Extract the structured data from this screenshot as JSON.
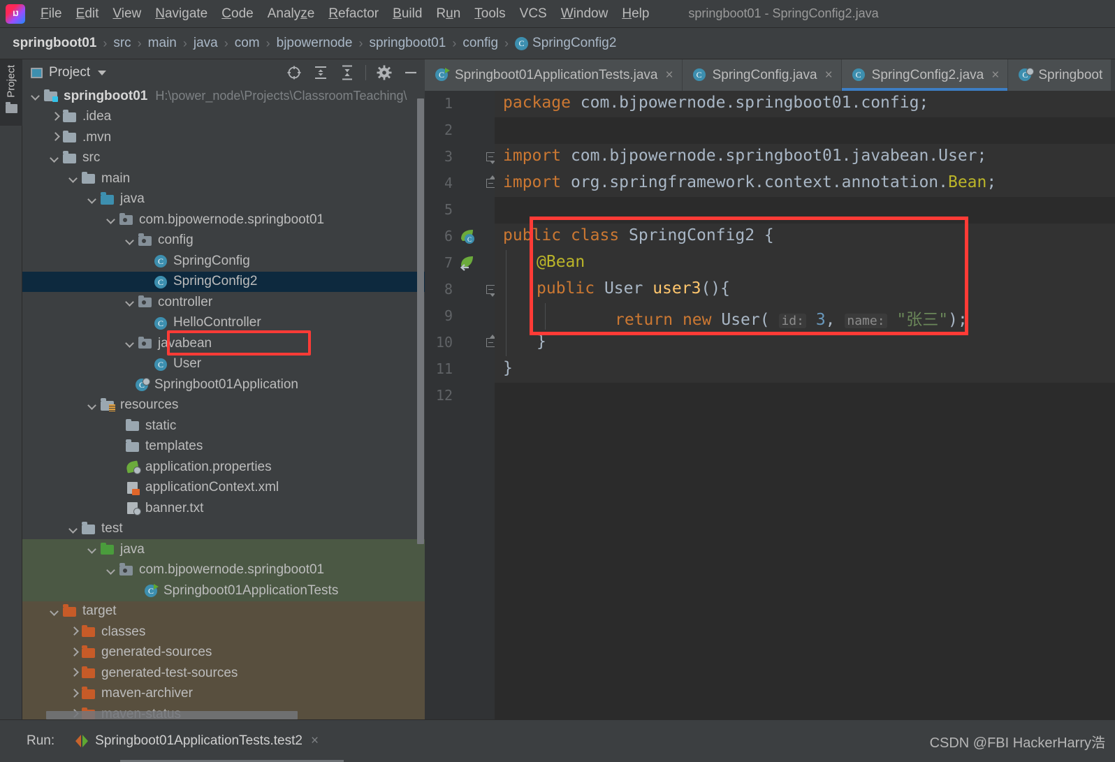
{
  "window": {
    "title": "springboot01 - SpringConfig2.java",
    "logo_icon": "intellij-idea-logo"
  },
  "menubar": {
    "items": [
      {
        "label": "File",
        "mnemonic": "F"
      },
      {
        "label": "Edit",
        "mnemonic": "E"
      },
      {
        "label": "View",
        "mnemonic": "V"
      },
      {
        "label": "Navigate",
        "mnemonic": "N"
      },
      {
        "label": "Code",
        "mnemonic": "C"
      },
      {
        "label": "Analyze",
        "mnemonic": "z"
      },
      {
        "label": "Refactor",
        "mnemonic": "R"
      },
      {
        "label": "Build",
        "mnemonic": "B"
      },
      {
        "label": "Run",
        "mnemonic": "u"
      },
      {
        "label": "Tools",
        "mnemonic": "T"
      },
      {
        "label": "VCS",
        "mnemonic": ""
      },
      {
        "label": "Window",
        "mnemonic": "W"
      },
      {
        "label": "Help",
        "mnemonic": "H"
      }
    ]
  },
  "breadcrumb": {
    "separator": "›",
    "items": [
      {
        "label": "springboot01",
        "root": true
      },
      {
        "label": "src"
      },
      {
        "label": "main"
      },
      {
        "label": "java"
      },
      {
        "label": "com"
      },
      {
        "label": "bjpowernode"
      },
      {
        "label": "springboot01"
      },
      {
        "label": "config"
      },
      {
        "label": "SpringConfig2",
        "icon": "class-icon",
        "badge": "C"
      }
    ]
  },
  "left_strip": {
    "tab_label": "Project",
    "tab_icon": "folder-icon"
  },
  "project_panel": {
    "title": "Project",
    "title_icon": "project-view-icon",
    "dropdown_icon": "chevron-down-icon",
    "toolbar": [
      {
        "name": "select-opened-file-icon",
        "label": "Select Opened File"
      },
      {
        "name": "expand-all-icon",
        "label": "Expand All"
      },
      {
        "name": "collapse-all-icon",
        "label": "Collapse All"
      },
      {
        "name": "gear-icon",
        "label": "Settings"
      },
      {
        "name": "hide-icon",
        "label": "Hide"
      }
    ],
    "tree": [
      {
        "label": "springboot01",
        "hint": "H:\\power_node\\Projects\\ClassroomTeaching\\",
        "depth": 0,
        "twisty": "down",
        "icon": "module-folder-icon",
        "bold": true
      },
      {
        "label": ".idea",
        "depth": 1,
        "twisty": "right",
        "icon": "folder-grey-icon"
      },
      {
        "label": ".mvn",
        "depth": 1,
        "twisty": "right",
        "icon": "folder-grey-icon"
      },
      {
        "label": "src",
        "depth": 1,
        "twisty": "down",
        "icon": "folder-grey-icon"
      },
      {
        "label": "main",
        "depth": 2,
        "twisty": "down",
        "icon": "folder-grey-icon"
      },
      {
        "label": "java",
        "depth": 3,
        "twisty": "down",
        "icon": "folder-source-blue-icon"
      },
      {
        "label": "com.bjpowernode.springboot01",
        "depth": 4,
        "twisty": "down",
        "icon": "package-icon"
      },
      {
        "label": "config",
        "depth": 5,
        "twisty": "down",
        "icon": "package-icon"
      },
      {
        "label": "SpringConfig",
        "depth": 6,
        "twisty": "none",
        "icon": "class-icon"
      },
      {
        "label": "SpringConfig2",
        "depth": 6,
        "twisty": "none",
        "icon": "class-icon",
        "selected": true,
        "highlighted": true
      },
      {
        "label": "controller",
        "depth": 5,
        "twisty": "down",
        "icon": "package-icon"
      },
      {
        "label": "HelloController",
        "depth": 6,
        "twisty": "none",
        "icon": "class-icon"
      },
      {
        "label": "javabean",
        "depth": 5,
        "twisty": "down",
        "icon": "package-icon"
      },
      {
        "label": "User",
        "depth": 6,
        "twisty": "none",
        "icon": "class-icon"
      },
      {
        "label": "Springboot01Application",
        "depth": 5,
        "twisty": "none",
        "icon": "spring-boot-runnable-class-icon"
      },
      {
        "label": "resources",
        "depth": 3,
        "twisty": "down",
        "icon": "folder-resources-icon"
      },
      {
        "label": "static",
        "depth": 4,
        "twisty": "none",
        "icon": "folder-grey-icon"
      },
      {
        "label": "templates",
        "depth": 4,
        "twisty": "none",
        "icon": "folder-grey-icon"
      },
      {
        "label": "application.properties",
        "depth": 4,
        "twisty": "none",
        "icon": "spring-properties-icon"
      },
      {
        "label": "applicationContext.xml",
        "depth": 4,
        "twisty": "none",
        "icon": "spring-xml-icon"
      },
      {
        "label": "banner.txt",
        "depth": 4,
        "twisty": "none",
        "icon": "text-file-icon"
      },
      {
        "label": "test",
        "depth": 2,
        "twisty": "down",
        "icon": "folder-grey-icon"
      },
      {
        "label": "java",
        "depth": 3,
        "twisty": "down",
        "icon": "folder-test-source-green-icon",
        "scope": "test"
      },
      {
        "label": "com.bjpowernode.springboot01",
        "depth": 4,
        "twisty": "down",
        "icon": "package-icon",
        "scope": "test"
      },
      {
        "label": "Springboot01ApplicationTests",
        "depth": 5,
        "twisty": "none",
        "icon": "test-class-icon",
        "scope": "test"
      },
      {
        "label": "target",
        "depth": 1,
        "twisty": "down",
        "icon": "folder-excluded-orange-icon",
        "scope": "target"
      },
      {
        "label": "classes",
        "depth": 2,
        "twisty": "right",
        "icon": "folder-excluded-orange-icon",
        "scope": "target"
      },
      {
        "label": "generated-sources",
        "depth": 2,
        "twisty": "right",
        "icon": "folder-excluded-orange-icon",
        "scope": "target"
      },
      {
        "label": "generated-test-sources",
        "depth": 2,
        "twisty": "right",
        "icon": "folder-excluded-orange-icon",
        "scope": "target"
      },
      {
        "label": "maven-archiver",
        "depth": 2,
        "twisty": "right",
        "icon": "folder-excluded-orange-icon",
        "scope": "target"
      },
      {
        "label": "maven-status",
        "depth": 2,
        "twisty": "right",
        "icon": "folder-excluded-orange-icon",
        "scope": "target"
      }
    ]
  },
  "editor": {
    "tabs": [
      {
        "label": "Springboot01ApplicationTests.java",
        "icon": "test-class-icon",
        "active": false,
        "close_icon": "×"
      },
      {
        "label": "SpringConfig.java",
        "icon": "class-icon",
        "active": false,
        "close_icon": "×"
      },
      {
        "label": "SpringConfig2.java",
        "icon": "class-icon",
        "active": true,
        "close_icon": "×"
      },
      {
        "label": "Springboot",
        "icon": "spring-boot-runnable-class-icon",
        "active": false,
        "close_icon": ""
      }
    ],
    "line_numbers": [
      "1",
      "2",
      "3",
      "4",
      "5",
      "6",
      "7",
      "8",
      "9",
      "10",
      "11",
      "12"
    ],
    "gutter_icons": [
      {
        "line": 6,
        "name": "spring-bean-class-gutter-icon"
      },
      {
        "line": 7,
        "name": "spring-bean-method-gutter-icon"
      }
    ],
    "code": {
      "l1": {
        "kw": "package",
        "rest": " com.bjpowernode.springboot01.config;"
      },
      "l3": {
        "kw": "import",
        "rest": " com.bjpowernode.springboot01.javabean.User;"
      },
      "l4": {
        "kw": "import",
        "rest": " org.springframework.context.annotation.",
        "hl": "Bean",
        "tail": ";"
      },
      "l6": {
        "kw1": "public",
        "kw2": "class",
        "name": " SpringConfig2 {"
      },
      "l7": {
        "annotation": "@Bean"
      },
      "l8": {
        "kw1": "public",
        "type": " User",
        "method": " user3",
        "rest": "(){"
      },
      "l9": {
        "kw1": "return",
        "kw2": "new",
        "type": " User",
        "paren_open": "( ",
        "hint1": "id:",
        "num": " 3",
        "comma": ", ",
        "hint2": "name:",
        "str": " \"张三\"",
        "paren_close": ");"
      },
      "l10": {
        "brace": "}"
      },
      "l11": {
        "brace": "}"
      }
    }
  },
  "bottom": {
    "run_label": "Run:",
    "run_config": "Springboot01ApplicationTests.test2",
    "run_config_icon": "run-configuration-icon",
    "close_icon": "×",
    "watermark": "CSDN @FBI HackerHarry浩"
  },
  "colors": {
    "accent_blue": "#3d7ec4",
    "annotation_red": "#ff3b36",
    "selection_blue": "#0d293e",
    "test_scope_green": "#4b5844",
    "target_scope_brown": "#584f3e",
    "keyword_orange": "#cc7832",
    "annotation_yellow": "#bbb529",
    "string_green": "#6a8759",
    "number_blue": "#6897bb",
    "editor_bg": "#2b2b2b",
    "panel_bg": "#3c3f41"
  }
}
